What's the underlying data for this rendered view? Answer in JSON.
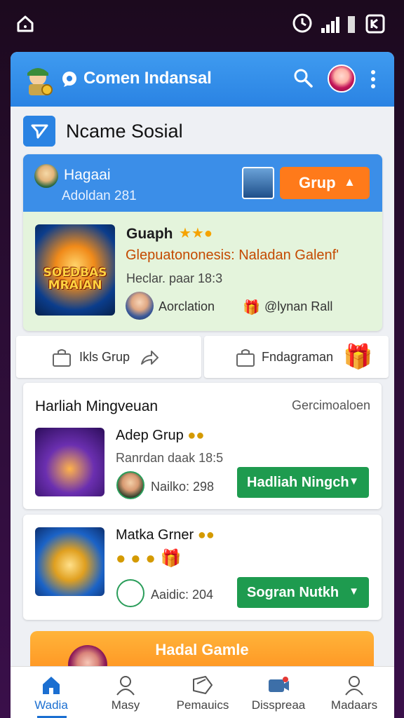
{
  "status_bar": {
    "icons": [
      "home-icon",
      "clock-icon",
      "signal-icon",
      "battery-icon",
      "cast-icon"
    ]
  },
  "header": {
    "title": "Comen Indansal"
  },
  "section": {
    "name": "Nсame Sosial"
  },
  "group_card": {
    "header_name": "Hagaai",
    "header_sub": "Adoldan 281",
    "grup_button": "Grup",
    "thumb_text": "SOEDBAS MRAIAN",
    "title": "Guaph",
    "description": "Glepuatononesis: Naladan Galenf'",
    "date": "Heclar. paar 18:3",
    "author": "Aorclation",
    "member": "@lynan Rall"
  },
  "actions": {
    "left_label": "Ikls Grup",
    "right_label": "Fndagraman"
  },
  "reward_section": {
    "title": "Harliah Mingveuan",
    "link": "Gercimoaloen",
    "item1": {
      "title": "Adep Grup",
      "sub": "Ranrdan daak 18:5",
      "meta": "Nailko: 298",
      "button": "Hadliah Ningch"
    }
  },
  "reward_card2": {
    "title": "Matka Grner",
    "meta": "Aaidic: 204",
    "button": "Sogran Nutkh"
  },
  "promo": {
    "text": "Hadal Gamle"
  },
  "nav": {
    "items": [
      {
        "label": "Wadia",
        "icon": "home-icon",
        "active": true
      },
      {
        "label": "Masy",
        "icon": "person-icon"
      },
      {
        "label": "Pemauics",
        "icon": "tag-icon"
      },
      {
        "label": "Disspreaa",
        "icon": "video-icon"
      },
      {
        "label": "Madaars",
        "icon": "person-icon"
      }
    ]
  },
  "colors": {
    "header_blue": "#2a83e3",
    "orange": "#ff7a1a",
    "green": "#1e9b4f",
    "card_green": "#e4f4dc"
  }
}
